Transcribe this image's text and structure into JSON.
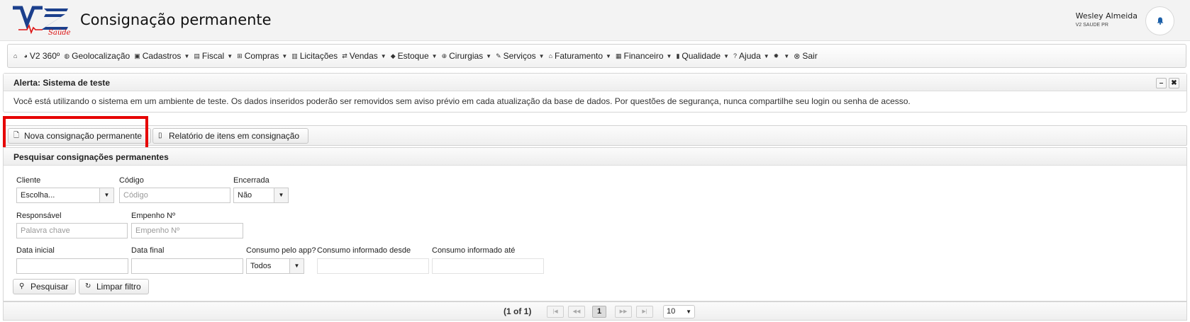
{
  "header": {
    "logo_text": "V2 Saúde",
    "title": "Consignação permanente",
    "user_name": "Wesley Almeida",
    "user_org": "V2 SAUDE PR",
    "bell_icon": "bell-icon"
  },
  "menubar": {
    "items": [
      {
        "label": "",
        "icon": "home-icon"
      },
      {
        "label": "V2 360º",
        "icon": "pie-chart-icon"
      },
      {
        "label": "Geolocalização",
        "icon": "globe-icon"
      },
      {
        "label": "Cadastros",
        "icon": "drawer-icon",
        "dropdown": true
      },
      {
        "label": "Fiscal",
        "icon": "document-icon",
        "dropdown": true
      },
      {
        "label": "Compras",
        "icon": "basket-icon",
        "dropdown": true
      },
      {
        "label": "Licitações",
        "icon": "building-icon"
      },
      {
        "label": "Vendas",
        "icon": "arrows-icon",
        "dropdown": true
      },
      {
        "label": "Estoque",
        "icon": "tag-icon",
        "dropdown": true
      },
      {
        "label": "Cirurgias",
        "icon": "plus-circle-icon",
        "dropdown": true
      },
      {
        "label": "Serviços",
        "icon": "wrench-icon",
        "dropdown": true
      },
      {
        "label": "Faturamento",
        "icon": "bank-icon",
        "dropdown": true
      },
      {
        "label": "Financeiro",
        "icon": "calculator-icon",
        "dropdown": true
      },
      {
        "label": "Qualidade",
        "icon": "book-icon",
        "dropdown": true
      },
      {
        "label": "Ajuda",
        "icon": "question-icon",
        "dropdown": true
      },
      {
        "label": "",
        "icon": "gear-icon",
        "dropdown": true
      },
      {
        "label": "Sair",
        "icon": "close-circle-icon"
      }
    ]
  },
  "alert": {
    "title": "Alerta: Sistema de teste",
    "message": "Você está utilizando o sistema em um ambiente de teste. Os dados inseridos poderão ser removidos sem aviso prévio em cada atualização da base de dados. Por questões de segurança, nunca compartilhe seu login ou senha de acesso.",
    "minimize_label": "–",
    "close_label": "✖"
  },
  "toolbar": {
    "new_label": "Nova consignação permanente",
    "report_label": "Relatório de itens em consignação"
  },
  "search": {
    "title": "Pesquisar consignações permanentes",
    "cliente_label": "Cliente",
    "cliente_value": "Escolha...",
    "codigo_label": "Código",
    "codigo_placeholder": "Código",
    "encerrada_label": "Encerrada",
    "encerrada_value": "Não",
    "responsavel_label": "Responsável",
    "responsavel_placeholder": "Palavra chave",
    "empenho_label": "Empenho Nº",
    "empenho_placeholder": "Empenho Nº",
    "data_inicial_label": "Data inicial",
    "data_final_label": "Data final",
    "consumo_app_label": "Consumo pelo app?",
    "consumo_app_value": "Todos",
    "consumo_desde_label": "Consumo informado desde",
    "consumo_ate_label": "Consumo informado até",
    "search_button": "Pesquisar",
    "clear_button": "Limpar filtro"
  },
  "pager": {
    "status": "(1 of 1)",
    "current_page": "1",
    "first": "|◀",
    "prev": "◀◀",
    "next": "▶▶",
    "last": "▶|",
    "rows_per_page": "10"
  }
}
